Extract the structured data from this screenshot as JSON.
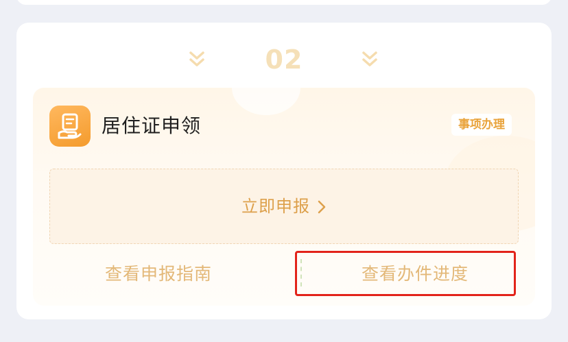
{
  "step": {
    "number": "02"
  },
  "service": {
    "title": "居住证申领",
    "tag": "事项办理",
    "icon": "hand-document-icon"
  },
  "actions": {
    "apply_label": "立即申报",
    "guide_label": "查看申报指南",
    "progress_label": "查看办件进度"
  },
  "colors": {
    "accent": "#f49b2d",
    "link": "#e3b878",
    "highlight": "#e2231a"
  }
}
